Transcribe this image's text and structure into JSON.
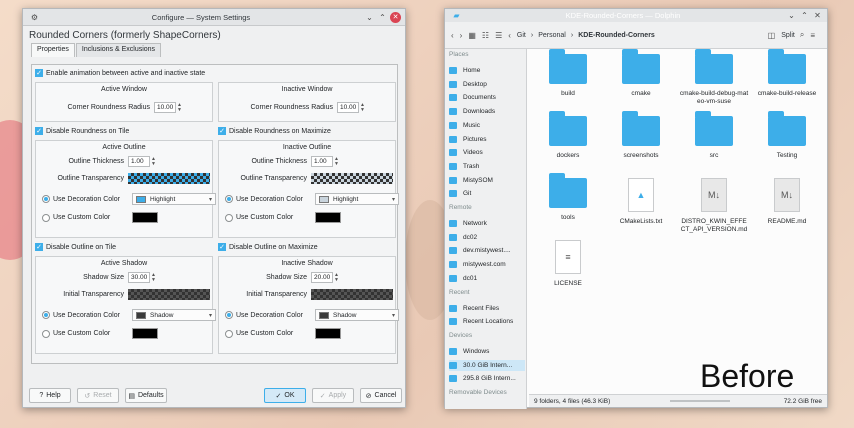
{
  "config_window": {
    "title": "Configure — System Settings",
    "header": "Rounded Corners (formerly ShapeCorners)",
    "tabs": [
      "Properties",
      "Inclusions & Exclusions"
    ],
    "enable_animation": "Enable animation between active and inactive state",
    "active_window": {
      "title": "Active Window",
      "radius_label": "Corner Roundness Radius",
      "radius_value": "10.00"
    },
    "inactive_window": {
      "title": "Inactive Window",
      "radius_label": "Corner Roundness Radius",
      "radius_value": "10.00"
    },
    "disable_roundness_tile": "Disable Roundness on Tile",
    "disable_roundness_max": "Disable Roundness on Maximize",
    "active_outline": {
      "title": "Active Outline",
      "thickness_label": "Outline Thickness",
      "thickness_value": "1.00",
      "transparency_label": "Outline Transparency",
      "use_decoration": "Use Decoration Color",
      "decoration_value": "Highlight",
      "use_custom": "Use Custom Color",
      "swatch_color": "#3daee9"
    },
    "inactive_outline": {
      "title": "Inactive Outline",
      "thickness_label": "Outline Thickness",
      "thickness_value": "1.00",
      "transparency_label": "Outline Transparency",
      "use_decoration": "Use Decoration Color",
      "decoration_value": "Highlight",
      "use_custom": "Use Custom Color",
      "swatch_color": "#c9d4dd"
    },
    "disable_outline_tile": "Disable Outline on Tile",
    "disable_outline_max": "Disable Outline on Maximize",
    "active_shadow": {
      "title": "Active Shadow",
      "size_label": "Shadow Size",
      "size_value": "30.00",
      "transparency_label": "Initial Transparency",
      "use_decoration": "Use Decoration Color",
      "decoration_value": "Shadow",
      "use_custom": "Use Custom Color",
      "swatch_color": "#3b3b3b"
    },
    "inactive_shadow": {
      "title": "Inactive Shadow",
      "size_label": "Shadow Size",
      "size_value": "20.00",
      "transparency_label": "Initial Transparency",
      "use_decoration": "Use Decoration Color",
      "decoration_value": "Shadow",
      "use_custom": "Use Custom Color",
      "swatch_color": "#3b3b3b"
    },
    "buttons": {
      "help": "Help",
      "reset": "Reset",
      "defaults": "Defaults",
      "ok": "OK",
      "apply": "Apply",
      "cancel": "Cancel"
    }
  },
  "file_manager": {
    "title": "KDE-Rounded-Corners — Dolphin",
    "split": "Split",
    "breadcrumb": [
      "Git",
      "Personal",
      "KDE-Rounded-Corners"
    ],
    "places_header": "Places",
    "places": [
      "Home",
      "Desktop",
      "Documents",
      "Downloads",
      "Music",
      "Pictures",
      "Videos",
      "Trash",
      "MistySOM",
      "Git"
    ],
    "remote_header": "Remote",
    "remote": [
      "Network",
      "dc02",
      "dev.mistywest....",
      "mistywest.com",
      "dc01"
    ],
    "recent_header": "Recent",
    "recent": [
      "Recent Files",
      "Recent Locations"
    ],
    "devices_header": "Devices",
    "devices": [
      "Windows",
      "30.0 GiB Intern...",
      "295.8 GiB Intern..."
    ],
    "removable_header": "Removable Devices",
    "files": [
      {
        "name": "build",
        "kind": "folder"
      },
      {
        "name": "cmake",
        "kind": "folder"
      },
      {
        "name": "cmake-build-debug-mateo-vm-suse",
        "kind": "folder"
      },
      {
        "name": "cmake-build-release",
        "kind": "folder"
      },
      {
        "name": "dockers",
        "kind": "folder"
      },
      {
        "name": "screenshots",
        "kind": "folder"
      },
      {
        "name": "src",
        "kind": "folder"
      },
      {
        "name": "Testing",
        "kind": "folder"
      },
      {
        "name": "tools",
        "kind": "folder"
      },
      {
        "name": "CMakeLists.txt",
        "kind": "cmake"
      },
      {
        "name": "DISTRO_KWIN_EFFECT_API_VERSION.md",
        "kind": "md"
      },
      {
        "name": "README.md",
        "kind": "md"
      },
      {
        "name": "LICENSE",
        "kind": "text"
      }
    ],
    "status": "9 folders, 4 files (46.3 KiB)",
    "free": "72.2 GiB free"
  },
  "overlay_label": "Before"
}
